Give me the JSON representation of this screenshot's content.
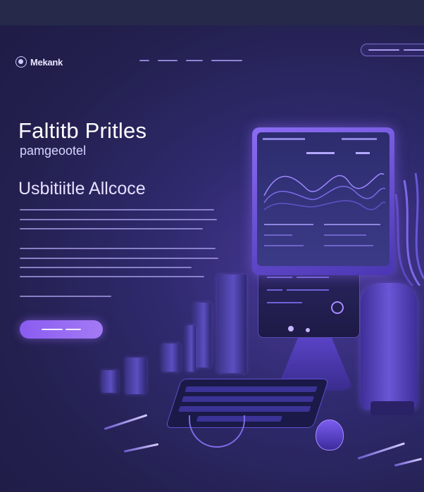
{
  "header": {
    "logo_text": "Mekank",
    "logo_icon": "circle-logo-icon",
    "nav_items": [
      {
        "name": "nav-link-1",
        "width": 14
      },
      {
        "name": "nav-link-2",
        "width": 28
      },
      {
        "name": "nav-link-3",
        "width": 24
      },
      {
        "name": "nav-link-4",
        "width": 44
      }
    ],
    "cta_pill": "outlined-pill-button"
  },
  "hero": {
    "title": "Faltitb Pritles",
    "subline": "pamgeootel",
    "subtitle": "Usbitiitle Allcoce",
    "button": "primary-cta-button"
  },
  "colors": {
    "background": "#2a2660",
    "accent": "#8a5cf0",
    "text": "#ffffff"
  }
}
